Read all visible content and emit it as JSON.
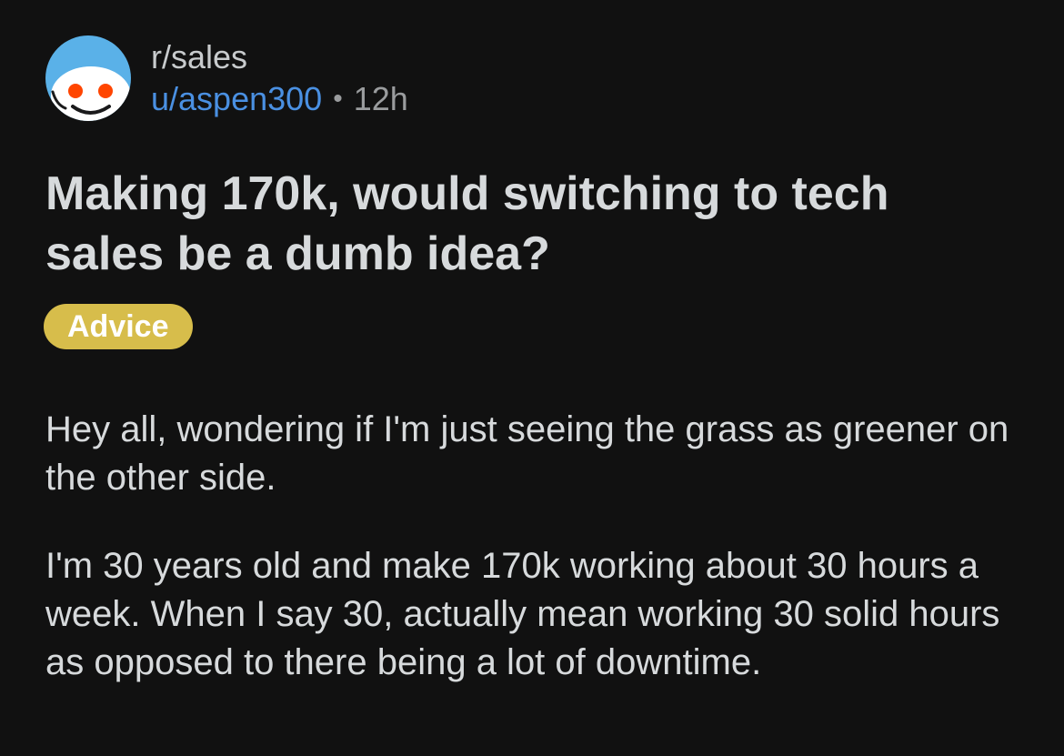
{
  "post": {
    "subreddit": "r/sales",
    "username": "u/aspen300",
    "separator": "•",
    "age": "12h",
    "title": "Making 170k, would switching to tech sales be a dumb idea?",
    "flair": "Advice",
    "paragraphs": [
      "Hey all, wondering if I'm just seeing the grass as greener on the other side.",
      "I'm 30 years old and make 170k working about 30 hours a week. When I say 30, actually mean working 30 solid hours as opposed to there being a lot of downtime."
    ]
  },
  "icons": {
    "avatar": "reddit-snoo-avatar-icon"
  },
  "colors": {
    "background": "#111111",
    "username": "#4a90e2",
    "flair": "#d7bd4b",
    "avatar_bg": "#5ab1e8"
  }
}
